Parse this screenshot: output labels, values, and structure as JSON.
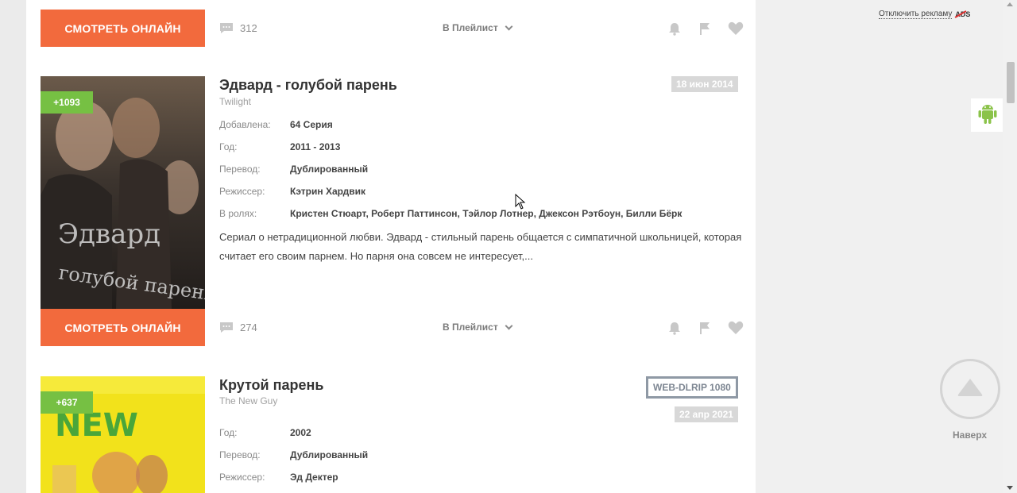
{
  "colors": {
    "watch_button": "#f26a3d",
    "badge": "#76c043",
    "date_bg": "#d8d8d8"
  },
  "watch_label": "СМОТРЕТЬ ОНЛАЙН",
  "playlist_label": "В Плейлист",
  "top_item": {
    "comments": "312"
  },
  "items": [
    {
      "badge": "+1093",
      "title": "Эдвард - голубой парень",
      "original_title": "Twilight",
      "date": "18 июн 2014",
      "poster_text": "Эдвард голубой парень",
      "info": [
        {
          "label": "Добавлена:",
          "value": "64 Серия"
        },
        {
          "label": "Год:",
          "value": "2011 - 2013"
        },
        {
          "label": "Перевод:",
          "value": "Дублированный"
        },
        {
          "label": "Режиссер:",
          "value": "Кэтрин Хардвик"
        },
        {
          "label": "В ролях:",
          "value": "Кристен Стюарт, Роберт Паттинсон, Тэйлор Лотнер, Джексон Рэтбоун, Билли Бёрк"
        }
      ],
      "description": "Сериал о нетрадиционной любви. Эдвард - стильный парень общается с симпатичной школьницей, которая считает его своим парнем. Но парня она совсем не интересует,...",
      "comments": "274"
    },
    {
      "badge": "+637",
      "title": "Крутой парень",
      "original_title": "The New Guy",
      "quality": "WEB-DLRIP 1080",
      "date": "22 апр 2021",
      "poster_text": "THE NEW GUY",
      "info": [
        {
          "label": "Год:",
          "value": "2002"
        },
        {
          "label": "Перевод:",
          "value": "Дублированный"
        },
        {
          "label": "Режиссер:",
          "value": "Эд Дектер"
        }
      ]
    }
  ],
  "sidebar": {
    "disable_ads": "Отключить рекламу",
    "ads_logo": "ADS",
    "to_top": "Наверх"
  },
  "icons": [
    "comment-icon",
    "chevron-down-icon",
    "bell-icon",
    "flag-icon",
    "heart-icon",
    "android-icon",
    "arrow-up-icon",
    "cursor-icon"
  ]
}
